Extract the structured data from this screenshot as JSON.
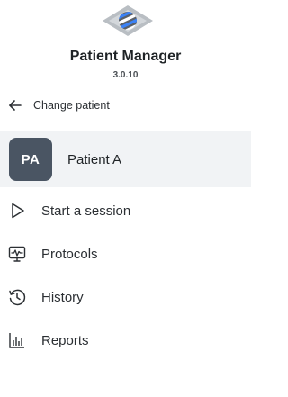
{
  "app": {
    "title": "Patient Manager",
    "version": "3.0.10"
  },
  "change_patient": {
    "label": "Change patient",
    "icon": "arrow-left-icon"
  },
  "patient": {
    "initials": "PA",
    "name": "Patient A",
    "avatar_color": "#4a5563"
  },
  "nav": {
    "items": [
      {
        "label": "Start a session",
        "icon": "play-icon"
      },
      {
        "label": "Protocols",
        "icon": "monitor-pulse-icon"
      },
      {
        "label": "History",
        "icon": "history-icon"
      },
      {
        "label": "Reports",
        "icon": "bar-chart-icon"
      }
    ]
  },
  "colors": {
    "selected_background": "#f1f3f5",
    "text": "#2b2f33"
  }
}
